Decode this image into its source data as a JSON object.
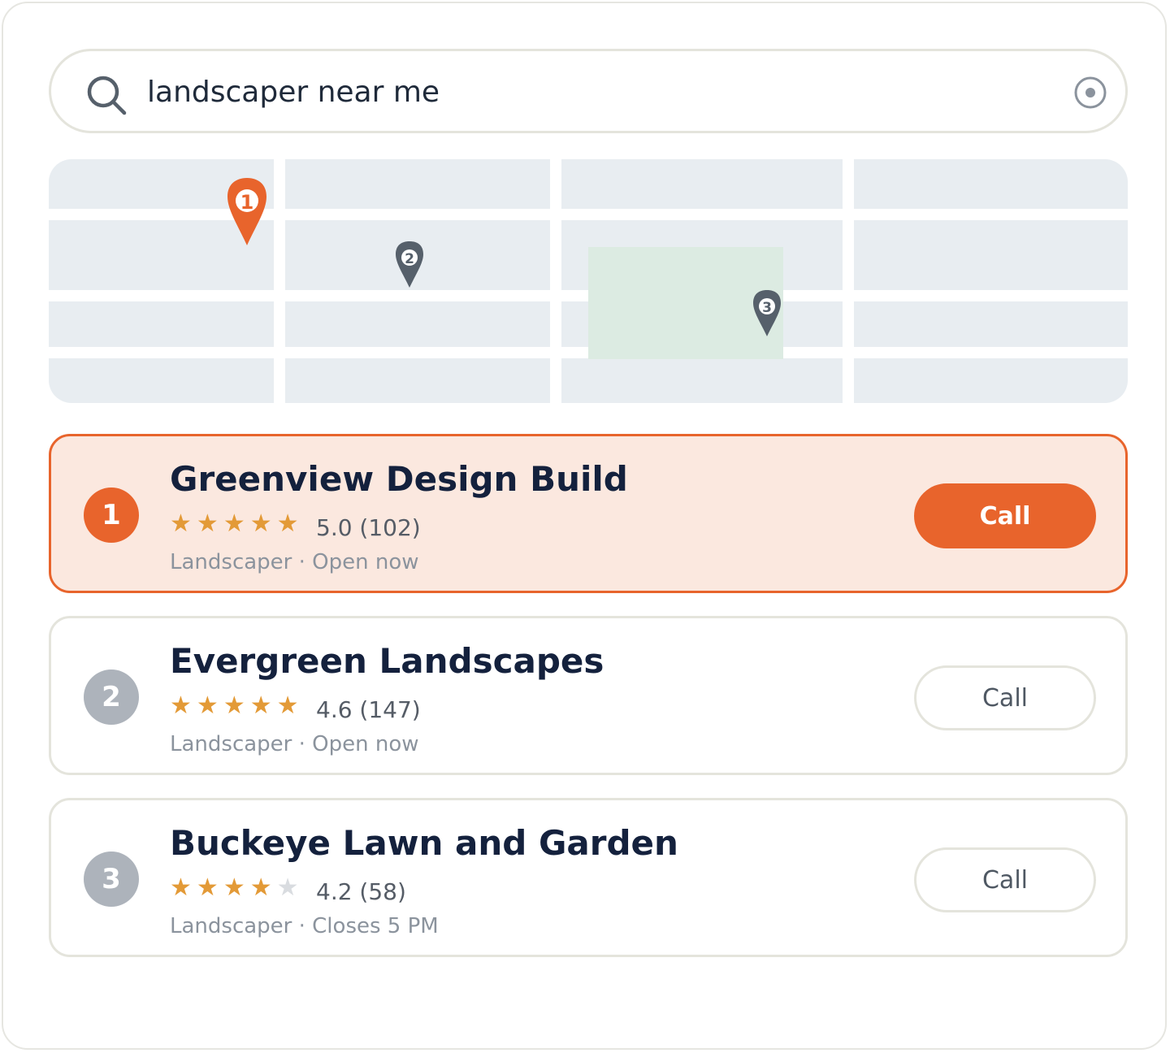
{
  "search": {
    "query": "landscaper near me"
  },
  "colors": {
    "accent": "#e8642c",
    "inactive_pin": "#56606b",
    "star": "#e39a37",
    "map_block": "#e8edf1",
    "map_park": "#dcebe2"
  },
  "icons": {
    "search": "search-icon",
    "location": "target-icon",
    "map_pin": "map-pin-icon",
    "star": "star-icon"
  },
  "map": {
    "pins": [
      {
        "label": "1",
        "active": true
      },
      {
        "label": "2",
        "active": false
      },
      {
        "label": "3",
        "active": false
      }
    ]
  },
  "results": [
    {
      "rank": "1",
      "name": "Greenview Design Build",
      "rating_value": 5.0,
      "rating_text": "5.0 (102)",
      "category_status": "Landscaper · Open now",
      "call_label": "Call",
      "selected": true
    },
    {
      "rank": "2",
      "name": "Evergreen Landscapes",
      "rating_value": 4.6,
      "rating_text": "4.6 (147)",
      "category_status": "Landscaper · Open now",
      "call_label": "Call",
      "selected": false
    },
    {
      "rank": "3",
      "name": "Buckeye Lawn and Garden",
      "rating_value": 4.2,
      "rating_text": "4.2 (58)",
      "category_status": "Landscaper · Closes 5 PM",
      "call_label": "Call",
      "selected": false
    }
  ]
}
